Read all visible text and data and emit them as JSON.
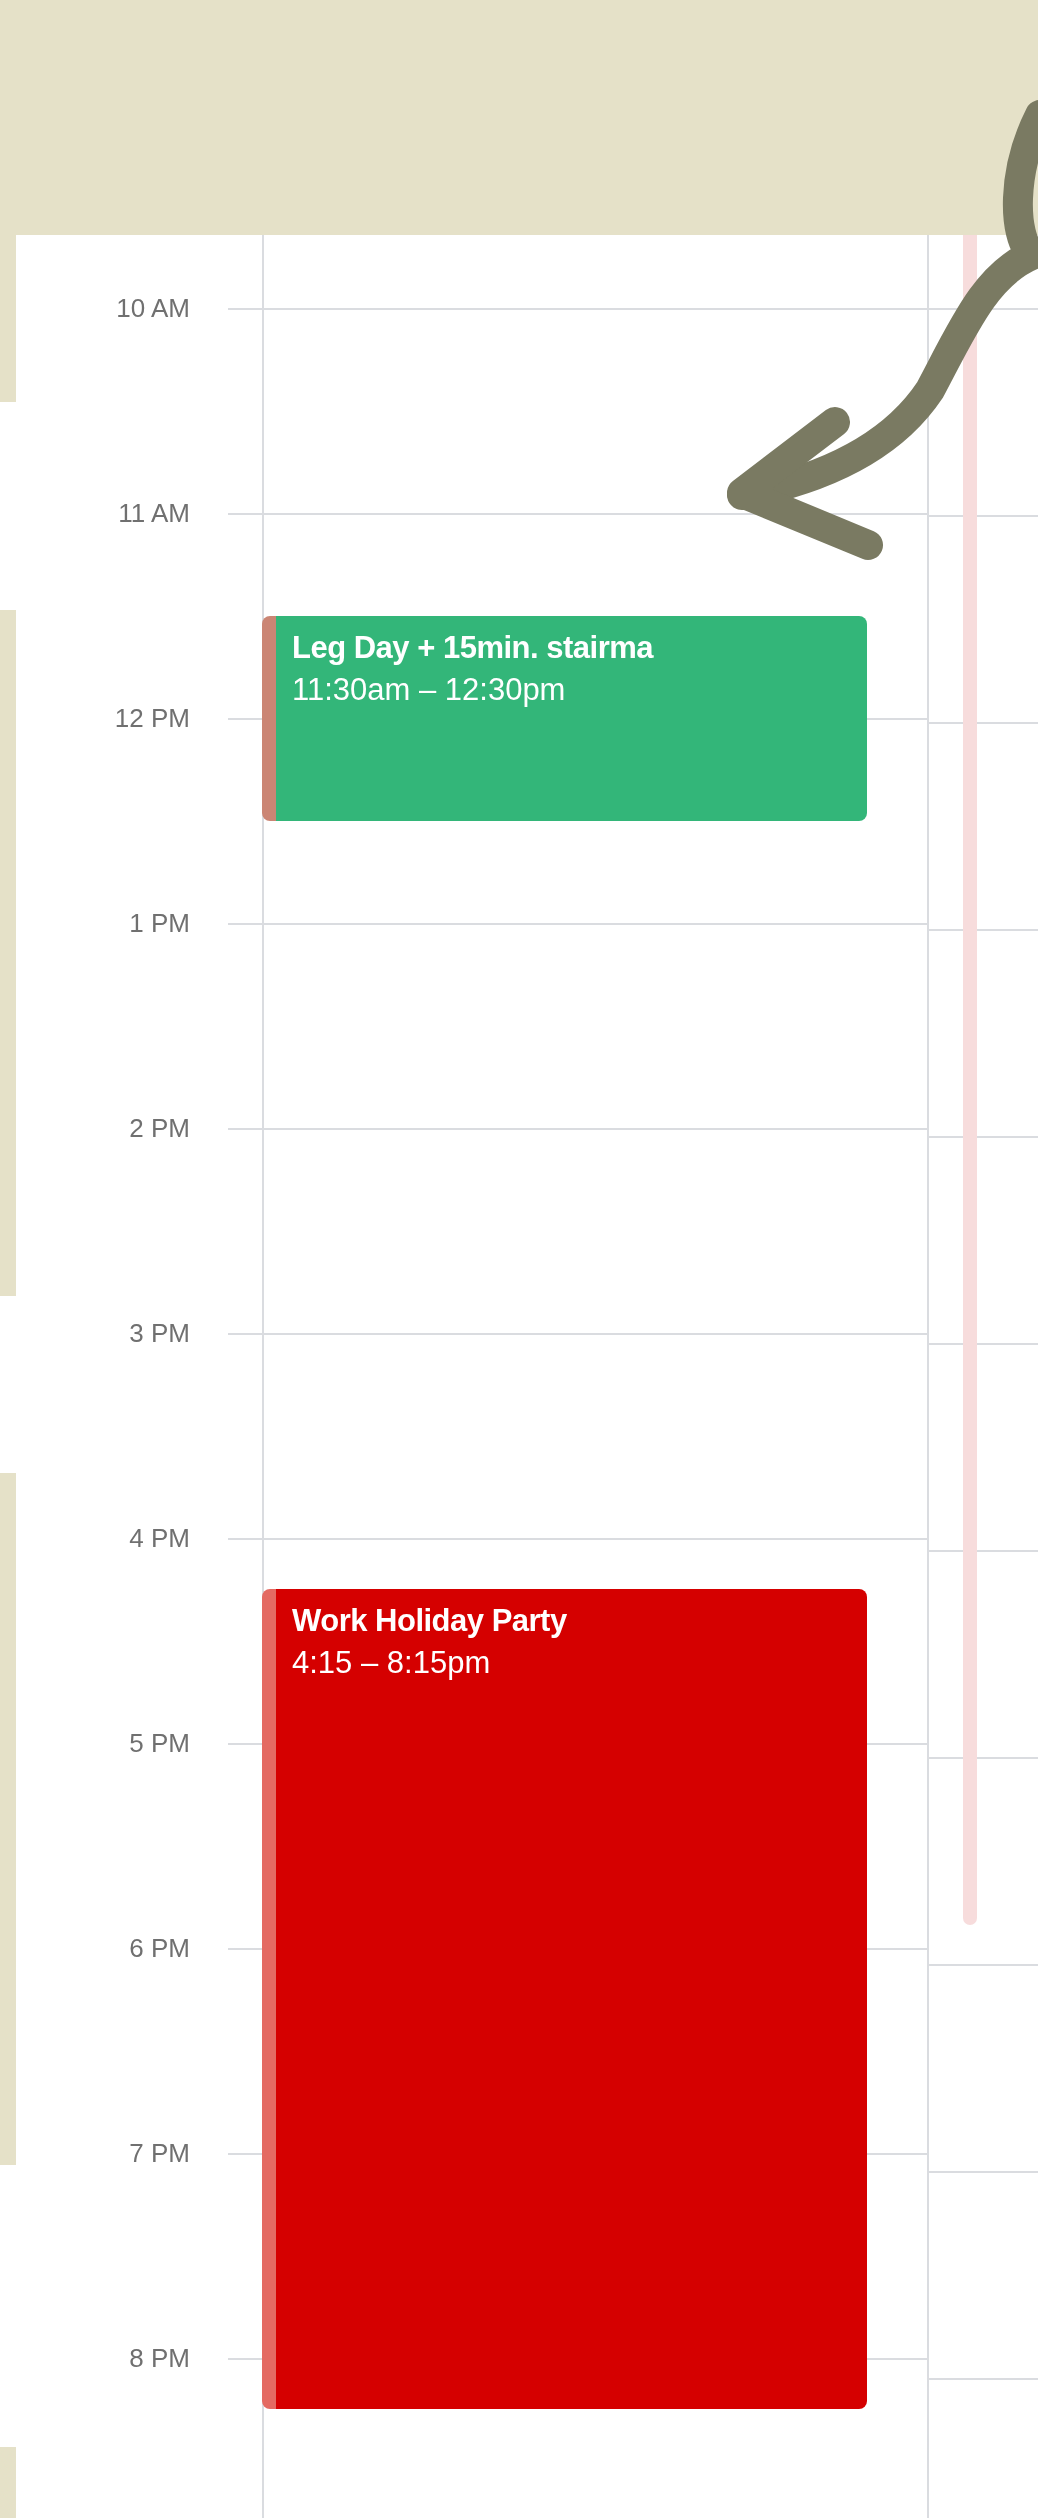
{
  "time_labels": [
    "10 AM",
    "11 AM",
    "12 PM",
    "1 PM",
    "2 PM",
    "3 PM",
    "4 PM",
    "5 PM",
    "6 PM",
    "7 PM",
    "8 PM"
  ],
  "events": [
    {
      "title": "Leg Day + 15min. stairma",
      "time": "11:30am – 12:30pm",
      "color": "#33b679"
    },
    {
      "title": "Work Holiday Party",
      "time": "4:15 – 8:15pm",
      "color": "#d50000"
    }
  ]
}
